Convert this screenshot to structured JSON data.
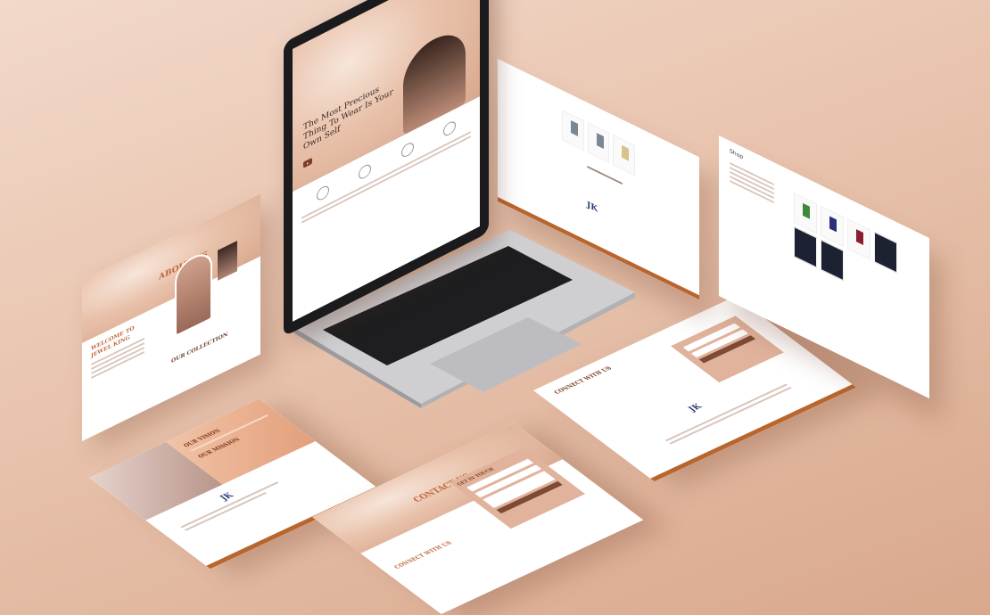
{
  "hero": {
    "headline": "The Most Precious Thing To Wear Is Your Own Self"
  },
  "about": {
    "title": "ABOUT US",
    "welcome": "WELCOME TO JEWEL KING",
    "collection": "OUR COLLECTION"
  },
  "vision": {
    "vision_title": "OUR VISION",
    "mission_title": "OUR MISSION"
  },
  "contact": {
    "title": "CONTACT US",
    "get_in_touch": "GET IN TOUCH",
    "connect": "CONNECT WITH US"
  },
  "connect_page": {
    "title": "CONNECT WITH US"
  },
  "shop": {
    "title": "Shop"
  },
  "colors": {
    "accent": "#c0673a",
    "footer": "#b8652e",
    "background": "#e8c3ad"
  },
  "icons": [
    "laptop-icon",
    "gem-pendant-icon",
    "logo-icon"
  ]
}
